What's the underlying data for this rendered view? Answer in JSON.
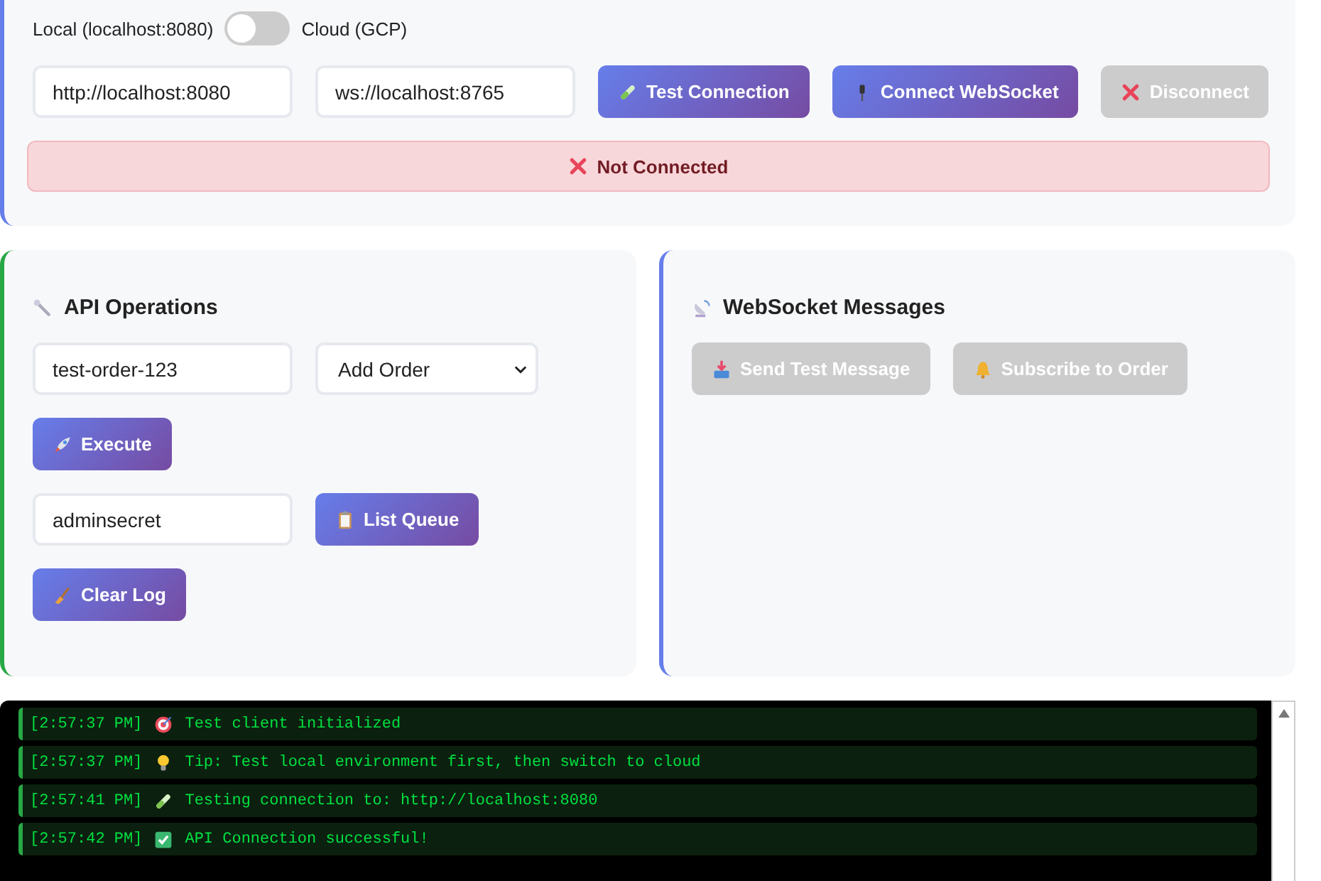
{
  "environment": {
    "left_label": "Local (localhost:8080)",
    "right_label": "Cloud (GCP)",
    "on": false
  },
  "connection": {
    "api_url": "http://localhost:8080",
    "ws_url": "ws://localhost:8765",
    "buttons": [
      {
        "label": "Test Connection",
        "disabled": false
      },
      {
        "label": "Connect WebSocket",
        "disabled": false
      },
      {
        "label": "Disconnect",
        "disabled": true
      }
    ],
    "status": {
      "text": "Not Connected",
      "connected": false
    }
  },
  "api_operations": {
    "title": "API Operations",
    "order_id": "test-order-123",
    "operation": "Add Order",
    "execute_button": "Execute",
    "admin_key": "adminsecret",
    "list_button": "List Queue",
    "clear_button": "Clear Log"
  },
  "websocket_messages": {
    "title": "WebSocket Messages",
    "buttons": [
      {
        "label": "Send Test Message",
        "disabled": true
      },
      {
        "label": "Subscribe to Order",
        "disabled": true
      }
    ]
  },
  "log": [
    {
      "time": "[2:57:37 PM]",
      "message": "Test client initialized"
    },
    {
      "time": "[2:57:37 PM]",
      "message": "Tip: Test local environment first, then switch to cloud"
    },
    {
      "time": "[2:57:41 PM]",
      "message": "Testing connection to: http://localhost:8080"
    },
    {
      "time": "[2:57:42 PM]",
      "message": "API Connection successful!"
    }
  ]
}
